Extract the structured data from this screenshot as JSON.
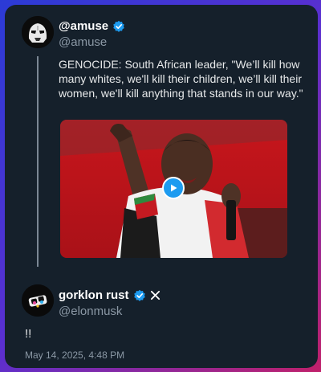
{
  "post": {
    "display_name": "@amuse",
    "handle": "@amuse",
    "verified_icon": "verified-badge-icon",
    "text": "GENOCIDE: South African leader, \"We’ll kill how many whites, we'll kill their children, we’ll kill their women, we'll kill anything that stands in our way.\"",
    "media": {
      "type": "video",
      "play_icon": "play-icon"
    }
  },
  "reply": {
    "display_name": "gorklon rust",
    "handle": "@elonmusk",
    "verified_icon": "verified-badge-icon",
    "affiliation_icon": "x-logo-icon",
    "text": "!!",
    "timestamp": "May 14, 2025, 4:48 PM"
  },
  "colors": {
    "card_bg": "#15202b",
    "text_primary": "#e7e9ea",
    "text_secondary": "#8b98a5",
    "verified_blue": "#1d9bf0"
  }
}
